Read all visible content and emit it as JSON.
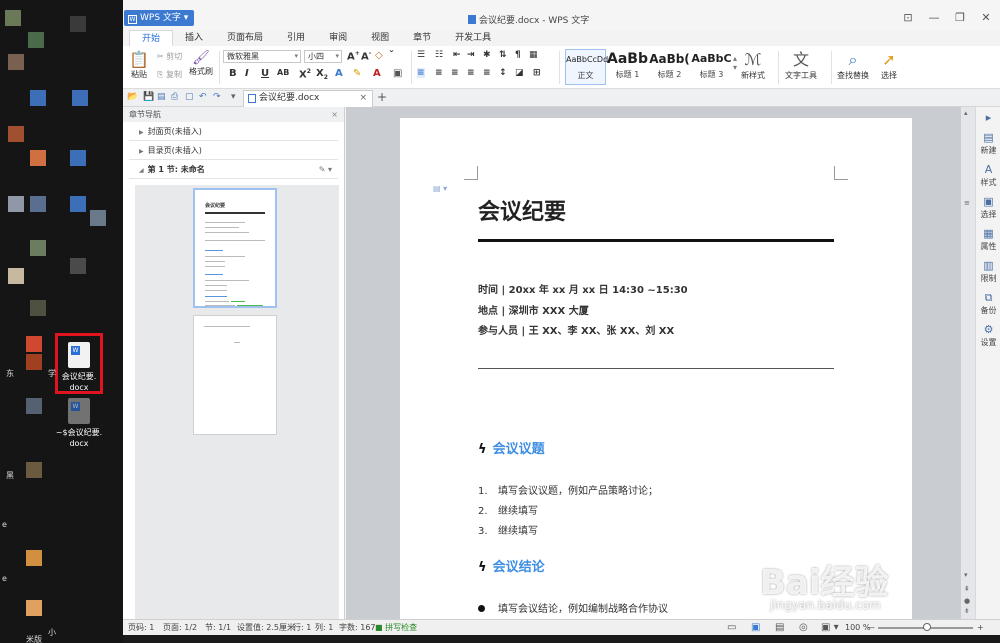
{
  "desktop": {
    "icon1_label": "会议纪要.\ndocx",
    "icon1_line1": "会议纪要.",
    "icon1_line2": "docx",
    "icon2_line1": "~$会议纪要.",
    "icon2_line2": "docx",
    "side_labels": [
      "东",
      "学",
      "黑",
      "小",
      "米版",
      "e",
      "e"
    ]
  },
  "window": {
    "app_menu": "WPS 文字",
    "title": "会议纪要.docx - WPS 文字"
  },
  "menu_tabs": [
    "开始",
    "插入",
    "页面布局",
    "引用",
    "审阅",
    "视图",
    "章节",
    "开发工具"
  ],
  "ribbon": {
    "paste": "粘贴",
    "cut": "剪切",
    "copy": "复制",
    "format_painter": "格式刷",
    "font_name": "微软雅黑",
    "font_size": "小四",
    "styles": [
      {
        "preview": "AaBbCcDd",
        "name": "正文"
      },
      {
        "preview": "AaBb",
        "name": "标题 1"
      },
      {
        "preview": "AaBb(",
        "name": "标题 2"
      },
      {
        "preview": "AaBbC",
        "name": "标题 3"
      }
    ],
    "new_style": "新样式",
    "text_tools": "文字工具",
    "find_replace": "查找替换",
    "select": "选择"
  },
  "tabbar": {
    "doc_tab": "会议纪要.docx"
  },
  "nav": {
    "header": "章节导航",
    "cover": "封面页(未插入)",
    "toc": "目录页(未插入)",
    "section1": "第 1 节: 未命名"
  },
  "document": {
    "title": "会议纪要",
    "time": "时间 | 20xx 年 xx 月 xx 日   14:30 ~15:30",
    "place": "地点 | 深圳市 XXX 大厦",
    "attendees": "参与人员 | 王 XX、李 XX、张 XX、刘 XX",
    "section1": "会议议题",
    "items1": [
      {
        "num": "1.",
        "text": "填写会议议题，例如产品策略讨论；"
      },
      {
        "num": "2.",
        "text": "继续填写"
      },
      {
        "num": "3.",
        "text": "继续填写"
      }
    ],
    "section2": "会议结论",
    "bullet1": "填写会议结论，例如编制战略合作协议"
  },
  "rail": [
    "新建",
    "样式",
    "选择",
    "属性",
    "限制",
    "备份",
    "设置"
  ],
  "status": {
    "page_no": "页码: 1",
    "pages": "页面: 1/2",
    "section": "节: 1/1",
    "setting": "设置值: 2.5厘米",
    "row": "行: 1",
    "col": "列: 1",
    "words": "字数: 167",
    "spell": "拼写检查",
    "zoom": "100 %"
  },
  "watermark": {
    "main": "Bai经验",
    "sub": "jingyan.baidu.com"
  },
  "colors": {
    "accent": "#3b7ad0",
    "heading_blue": "#3d8de3",
    "highlight_red": "#e0141e"
  }
}
